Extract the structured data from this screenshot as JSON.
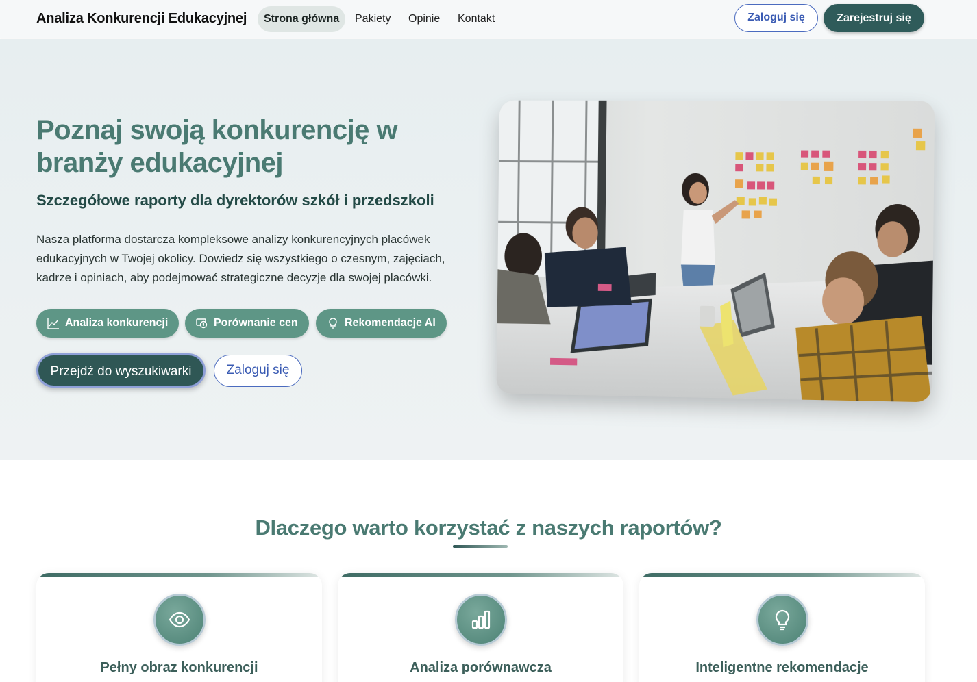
{
  "navbar": {
    "brand": "Analiza Konkurencji Edukacyjnej",
    "links": [
      {
        "label": "Strona główna",
        "active": true
      },
      {
        "label": "Pakiety",
        "active": false
      },
      {
        "label": "Opinie",
        "active": false
      },
      {
        "label": "Kontakt",
        "active": false
      }
    ],
    "login_label": "Zaloguj się",
    "register_label": "Zarejestruj się"
  },
  "hero": {
    "title": "Poznaj swoją konkurencję w branży edukacyjnej",
    "subtitle": "Szczegółowe raporty dla dyrektorów szkół i przedszkoli",
    "description": "Nasza platforma dostarcza kompleksowe analizy konkurencyjnych placówek edukacyjnych w Twojej okolicy. Dowiedz się wszystkiego o czesnym, zajęciach, kadrze i opiniach, aby podejmować strategiczne decyzje dla swojej placówki.",
    "chips": [
      {
        "label": "Analiza konkurencji",
        "icon": "chart-line-icon"
      },
      {
        "label": "Porównanie cen",
        "icon": "cash-icon"
      },
      {
        "label": "Rekomendacje AI",
        "icon": "lightbulb-icon"
      }
    ],
    "primary_button": "Przejdź do wyszukiwarki",
    "secondary_button": "Zaloguj się"
  },
  "features": {
    "title": "Dlaczego warto korzystać z naszych raportów?",
    "cards": [
      {
        "title": "Pełny obraz konkurencji",
        "icon": "eye-icon"
      },
      {
        "title": "Analiza porównawcza",
        "icon": "bar-chart-icon"
      },
      {
        "title": "Inteligentne rekomendacje",
        "icon": "lightbulb-icon"
      }
    ]
  },
  "colors": {
    "accent": "#4a7a72",
    "dark": "#2f5755",
    "chip": "#5e9686",
    "link_blue": "#3a5bb3"
  }
}
